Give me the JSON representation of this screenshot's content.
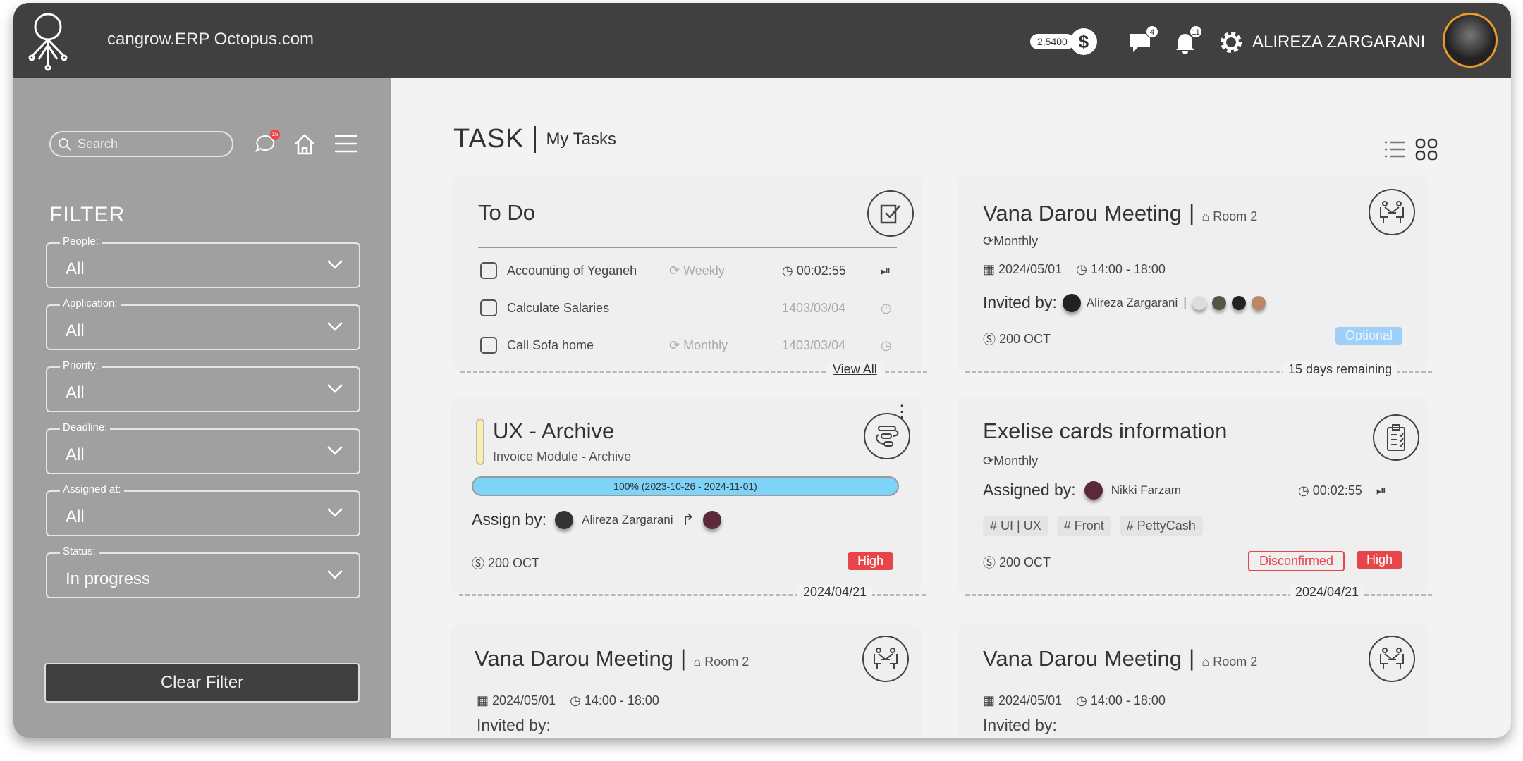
{
  "header": {
    "brand": "cangrow.ERP Octopus.com",
    "balance": "2,5400",
    "currency_symbol": "$",
    "messages_count": "4",
    "notifications_count": "11",
    "user_name": "ALIREZA ZARGARANI"
  },
  "sidebar": {
    "search_placeholder": "Search",
    "chat_badge": "15",
    "filter_title": "FILTER",
    "filters": [
      {
        "label": "People:",
        "value": "All"
      },
      {
        "label": "Application:",
        "value": "All"
      },
      {
        "label": "Priority:",
        "value": "All"
      },
      {
        "label": "Deadline:",
        "value": "All"
      },
      {
        "label": "Assigned at:",
        "value": "All"
      },
      {
        "label": "Status:",
        "value": "In progress"
      }
    ],
    "clear_label": "Clear Filter"
  },
  "page": {
    "title": "TASK",
    "subtitle": "My Tasks"
  },
  "todo": {
    "title": "To Do",
    "view_all": "View All",
    "items": [
      {
        "name": "Accounting of Yeganeh",
        "repeat": "Weekly",
        "time": "00:02:55"
      },
      {
        "name": "Calculate Salaries",
        "repeat": "",
        "time": "1403/03/04"
      },
      {
        "name": "Call Sofa home",
        "repeat": "Monthly",
        "time": "1403/03/04"
      }
    ]
  },
  "meeting1": {
    "title": "Vana Darou Meeting",
    "room": "Room 2",
    "repeat": "Monthly",
    "date": "2024/05/01",
    "time": "14:00 - 18:00",
    "invited_label": "Invited by:",
    "inviter": "Alireza Zargarani",
    "price": "200 OCT",
    "status": "Optional",
    "remaining": "15 days remaining"
  },
  "ux": {
    "title": "UX - Archive",
    "subtitle": "Invoice Module - Archive",
    "progress_text": "100% (2023-10-26 - 2024-11-01)",
    "progress": 100,
    "assign_label": "Assign by:",
    "assigner": "Alireza Zargarani",
    "price": "200 OCT",
    "priority": "High",
    "date": "2024/04/21"
  },
  "exelise": {
    "title": "Exelise cards information",
    "repeat": "Monthly",
    "assign_label": "Assigned by:",
    "assigner": "Nikki Farzam",
    "timer": "00:02:55",
    "tags": [
      "UI | UX",
      "Front",
      "PettyCash"
    ],
    "price": "200 OCT",
    "status": "Disconfirmed",
    "priority": "High",
    "date": "2024/04/21"
  },
  "meeting2": {
    "title": "Vana Darou Meeting",
    "room": "Room 2",
    "date": "2024/05/01",
    "time": "14:00 - 18:00",
    "invited_label": "Invited by:"
  },
  "meeting3": {
    "title": "Vana Darou Meeting",
    "room": "Room 2",
    "date": "2024/05/01",
    "time": "14:00 - 18:00",
    "invited_label": "Invited by:"
  },
  "colors": {
    "header": "#404040",
    "sidebar": "#a0a0a0",
    "progress": "#7dd3f8",
    "high": "#e8454a",
    "optional": "#9fd0fb"
  }
}
